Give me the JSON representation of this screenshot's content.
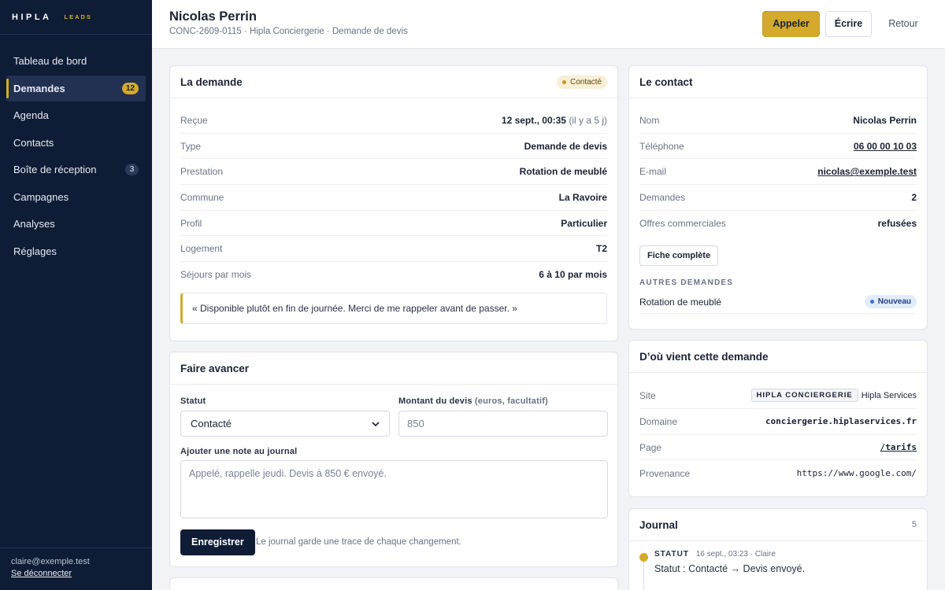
{
  "brand": {
    "logo": "HIPLA",
    "tag": "LEADS"
  },
  "sidebar": {
    "items": [
      {
        "label": "Tableau de bord",
        "badge": ""
      },
      {
        "label": "Demandes",
        "badge": "12"
      },
      {
        "label": "Agenda",
        "badge": ""
      },
      {
        "label": "Contacts",
        "badge": ""
      },
      {
        "label": "Boîte de réception",
        "badge": "3"
      },
      {
        "label": "Campagnes",
        "badge": ""
      },
      {
        "label": "Analyses",
        "badge": ""
      },
      {
        "label": "Réglages",
        "badge": ""
      }
    ],
    "user_email": "claire@exemple.test",
    "logout_label": "Se déconnecter"
  },
  "header": {
    "title": "Nicolas Perrin",
    "subtitle": "CONC-2609-0115 · Hipla Conciergerie · Demande de devis",
    "call_label": "Appeler",
    "write_label": "Écrire",
    "back_label": "Retour"
  },
  "request": {
    "title": "La demande",
    "status": "Contacté",
    "rows": [
      {
        "key": "Reçue",
        "value": "12 sept., 00:35",
        "extra": "(il y a 5 j)"
      },
      {
        "key": "Type",
        "value": "Demande de devis",
        "extra": ""
      },
      {
        "key": "Prestation",
        "value": "Rotation de meublé",
        "extra": ""
      },
      {
        "key": "Commune",
        "value": "La Ravoire",
        "extra": ""
      },
      {
        "key": "Profil",
        "value": "Particulier",
        "extra": ""
      },
      {
        "key": "Logement",
        "value": "T2",
        "extra": ""
      },
      {
        "key": "Séjours par mois",
        "value": "6 à 10 par mois",
        "extra": ""
      }
    ],
    "quote": "« Disponible plutôt en fin de journée. Merci de me rappeler avant de passer. »"
  },
  "progress": {
    "title": "Faire avancer",
    "status_label": "Statut",
    "status_value": "Contacté",
    "amount_label": "Montant du devis",
    "amount_hint": "(euros, facultatif)",
    "amount_value": "850",
    "note_label": "Ajouter une note au journal",
    "note_value": "Appelé, rappelle jeudi. Devis à 850 € envoyé.",
    "save_label": "Enregistrer",
    "save_hint": "Le journal garde une trace de chaque changement."
  },
  "contact": {
    "title": "Le contact",
    "rows": [
      {
        "key": "Nom",
        "value": "Nicolas Perrin"
      },
      {
        "key": "Téléphone",
        "value": "06 00 00 10 03"
      },
      {
        "key": "E-mail",
        "value": "nicolas@exemple.test"
      },
      {
        "key": "Demandes",
        "value": "2"
      },
      {
        "key": "Offres commerciales",
        "value": "refusées"
      }
    ],
    "full_profile_label": "Fiche complète",
    "other_requests_label": "AUTRES DEMANDES",
    "other_request": {
      "label": "Rotation de meublé",
      "badge": "Nouveau"
    }
  },
  "origin": {
    "title": "D’où vient cette demande",
    "site_key": "Site",
    "site_tag": "HIPLA CONCIERGERIE",
    "site_name": "Hipla Services",
    "domain_key": "Domaine",
    "domain_value": "conciergerie.hiplaservices.fr",
    "page_key": "Page",
    "page_value": "/tarifs",
    "source_key": "Provenance",
    "source_value": "https://www.google.com/"
  },
  "journal": {
    "title": "Journal",
    "count": "5",
    "entry": {
      "cap": "STATUT",
      "meta": "16 sept., 03:23 · Claire",
      "text": "Statut : Contacté → Devis envoyé."
    }
  },
  "colors": {
    "sidebar_bg": "#0f1c36",
    "accent": "#d4aa2c"
  }
}
